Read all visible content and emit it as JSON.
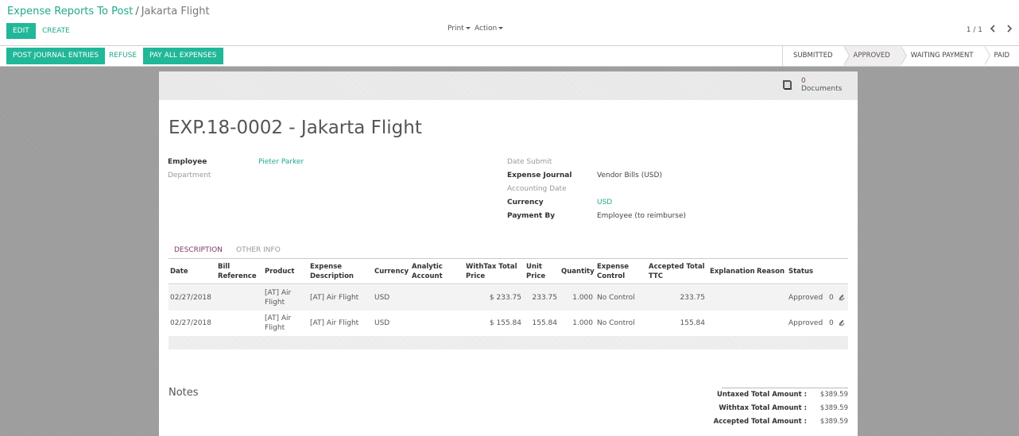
{
  "breadcrumb": {
    "parent": "Expense Reports To Post",
    "separator": "/",
    "current": "Jakarta Flight"
  },
  "buttons": {
    "edit": "EDIT",
    "create": "CREATE"
  },
  "dropdowns": {
    "print": "Print",
    "action": "Action"
  },
  "pager": {
    "value": "1 / 1",
    "prev_icon": "chevron-left-icon",
    "next_icon": "chevron-right-icon"
  },
  "statusbar": {
    "post": "POST JOURNAL ENTRIES",
    "refuse": "REFUSE",
    "pay": "PAY ALL EXPENSES",
    "stages": [
      "SUBMITTED",
      "APPROVED",
      "WAITING PAYMENT",
      "PAID"
    ],
    "active_stage": "APPROVED"
  },
  "documents": {
    "count": "0",
    "label": "Documents",
    "icon": "book-icon"
  },
  "title": "EXP.18-0002 - Jakarta Flight",
  "fields": {
    "employee_label": "Employee",
    "employee_value": "Pieter Parker",
    "department_label": "Department",
    "date_submit_label": "Date Submit",
    "journal_label": "Expense Journal",
    "journal_value": "Vendor Bills (USD)",
    "accounting_date_label": "Accounting Date",
    "currency_label": "Currency",
    "currency_value": "USD",
    "payment_by_label": "Payment By",
    "payment_by_value": "Employee (to reimburse)"
  },
  "tabs": [
    "DESCRIPTION",
    "OTHER INFO"
  ],
  "table": {
    "headers": {
      "date": "Date",
      "bill_ref_1": "Bill",
      "bill_ref_2": "Reference",
      "product": "Product",
      "exp_desc_1": "Expense",
      "exp_desc_2": "Description",
      "currency": "Currency",
      "analytic_1": "Analytic",
      "analytic_2": "Account",
      "withtax_1": "WithTax Total",
      "withtax_2": "Price",
      "unit_1": "Unit",
      "unit_2": "Price",
      "quantity": "Quantity",
      "control_1": "Expense",
      "control_2": "Control",
      "accepted_1": "Accepted Total",
      "accepted_2": "TTC",
      "explanation": "Explanation",
      "reason": "Reason",
      "status": "Status"
    },
    "rows": [
      {
        "date": "02/27/2018",
        "product_1": "[AT] Air",
        "product_2": "Flight",
        "description": "[AT] Air Flight",
        "currency": "USD",
        "withtax": "$ 233.75",
        "unit_price": "233.75",
        "quantity": "1.000",
        "control": "No Control",
        "accepted": "233.75",
        "status": "Approved",
        "attachments": "0"
      },
      {
        "date": "02/27/2018",
        "product_1": "[AT] Air",
        "product_2": "Flight",
        "description": "[AT] Air Flight",
        "currency": "USD",
        "withtax": "$ 155.84",
        "unit_price": "155.84",
        "quantity": "1.000",
        "control": "No Control",
        "accepted": "155.84",
        "status": "Approved",
        "attachments": "0"
      }
    ]
  },
  "notes_label": "Notes",
  "totals": {
    "untaxed_label": "Untaxed Total Amount :",
    "untaxed_value": "$389.59",
    "withtax_label": "Withtax Total Amount :",
    "withtax_value": "$389.59",
    "accepted_label": "Accepted Total Amount :",
    "accepted_value": "$389.59"
  }
}
